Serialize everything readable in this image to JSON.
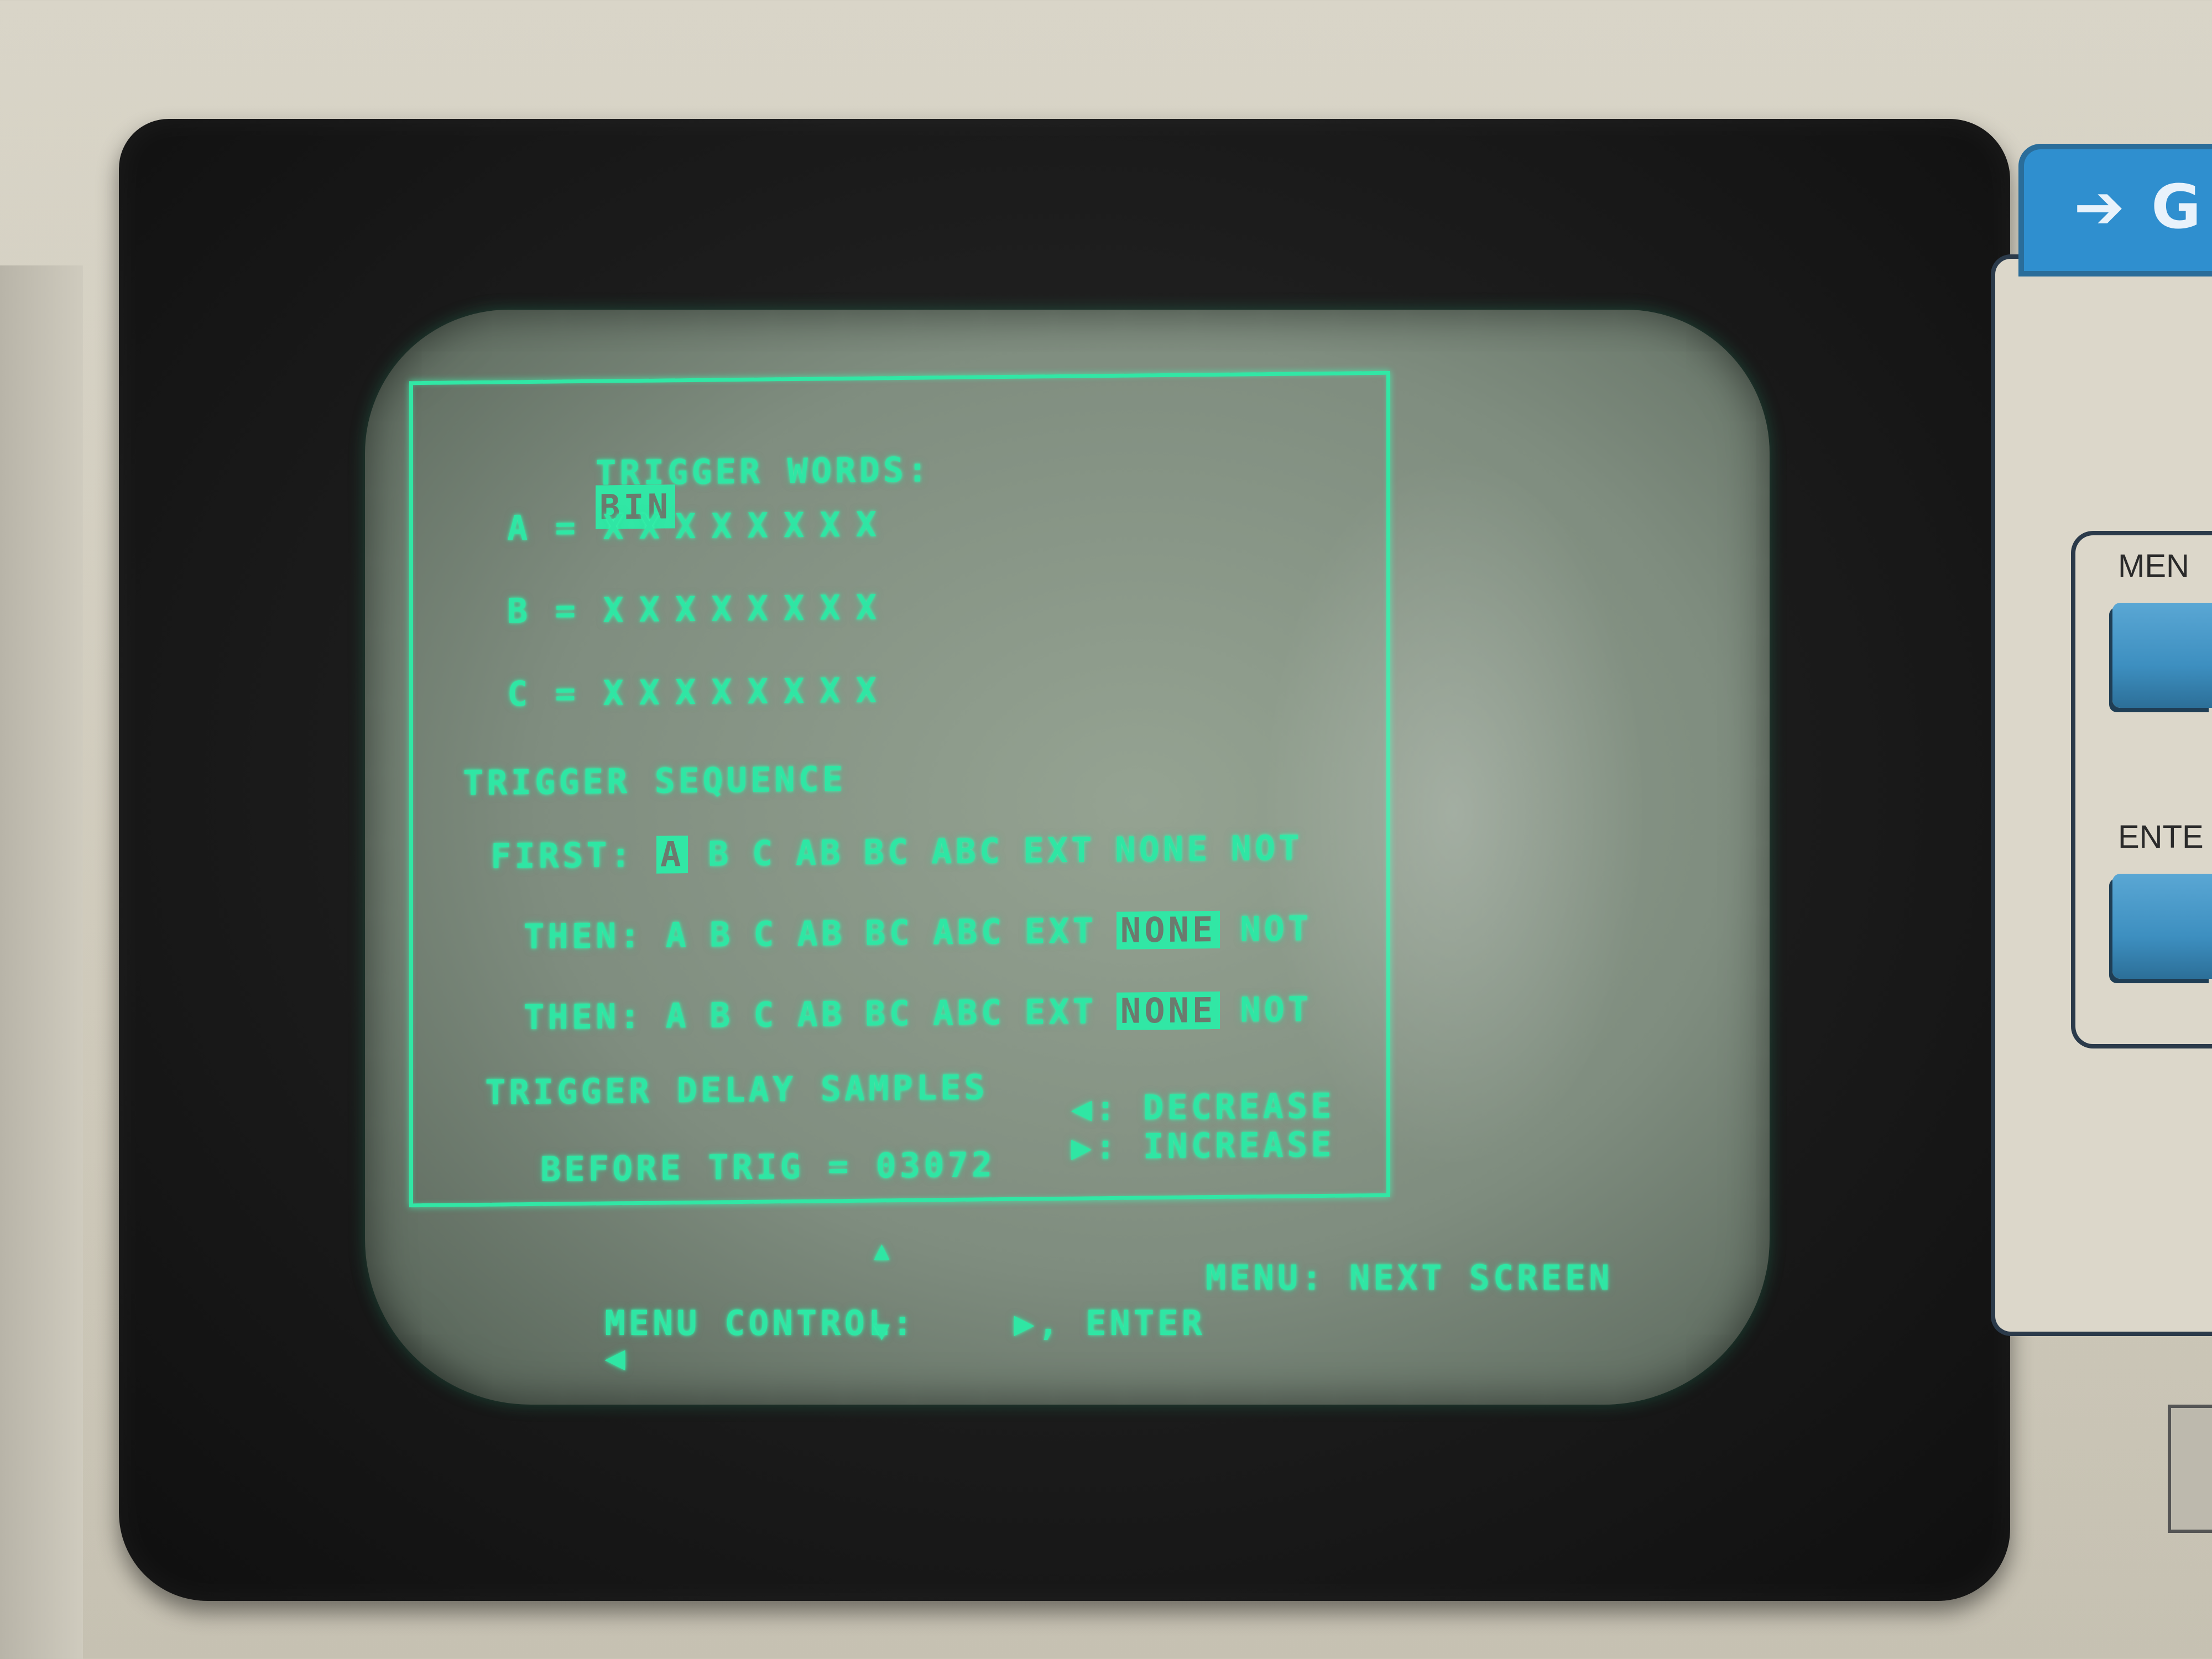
{
  "menu": {
    "trigger_words_label": "TRIGGER WORDS:",
    "trigger_words_mode": "BIN",
    "words": [
      {
        "name": "A",
        "eq": "=",
        "bits": [
          "X",
          "X",
          "X",
          "X",
          "X",
          "X",
          "X",
          "X"
        ]
      },
      {
        "name": "B",
        "eq": "=",
        "bits": [
          "X",
          "X",
          "X",
          "X",
          "X",
          "X",
          "X",
          "X"
        ]
      },
      {
        "name": "C",
        "eq": "=",
        "bits": [
          "X",
          "X",
          "X",
          "X",
          "X",
          "X",
          "X",
          "X"
        ]
      }
    ],
    "sequence_label": "TRIGGER SEQUENCE",
    "sequence_rows": [
      {
        "label": "FIRST:",
        "options": [
          "A",
          "B",
          "C",
          "AB",
          "BC",
          "ABC",
          "EXT",
          "NONE",
          "NOT"
        ],
        "selected": "A"
      },
      {
        "label": "THEN:",
        "options": [
          "A",
          "B",
          "C",
          "AB",
          "BC",
          "ABC",
          "EXT",
          "NONE",
          "NOT"
        ],
        "selected": "NONE"
      },
      {
        "label": "THEN:",
        "options": [
          "A",
          "B",
          "C",
          "AB",
          "BC",
          "ABC",
          "EXT",
          "NONE",
          "NOT"
        ],
        "selected": "NONE"
      }
    ],
    "delay_label": "TRIGGER DELAY SAMPLES",
    "before_trig_label": "BEFORE TRIG",
    "before_trig_eq": "=",
    "before_trig_value": "03072",
    "decrease_key": "◀",
    "decrease_label": ": DECREASE",
    "increase_key": "▶",
    "increase_label": ": INCREASE"
  },
  "footer": {
    "menu_control_label": "MENU CONTROL:",
    "left_arrow": "◀",
    "up_arrow": "▲",
    "down_arrow": "▼",
    "right_arrow": "▶",
    "enter_text": ", ENTER",
    "menu_hint": "MENU: NEXT SCREEN"
  },
  "panel": {
    "badge_glyph": "➔",
    "badge_text": "G",
    "menu_key_label": "MEN",
    "enter_key_label": "ENTE"
  },
  "colors": {
    "phosphor": "#2fe6a4",
    "screen": "#8a988a",
    "bezel": "#1b1b1b",
    "key_blue": "#3d8fc0",
    "badge_blue": "#2f8fcf"
  }
}
